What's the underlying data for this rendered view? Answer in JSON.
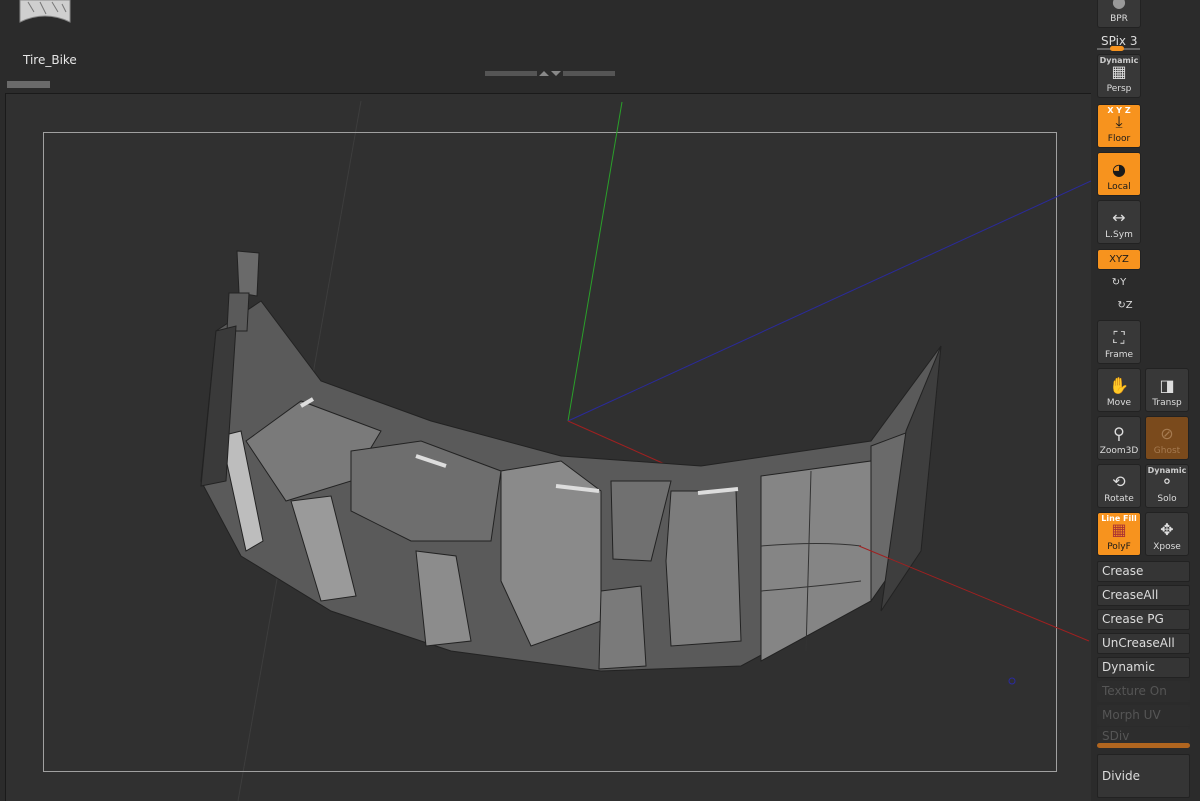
{
  "header": {
    "model_name": "Tire_Bike",
    "thumbnail": "tire-thumbnail"
  },
  "colors": {
    "accent": "#f7931e",
    "axis_x": "#b02020",
    "axis_y": "#20a020",
    "axis_z": "#2020a0"
  },
  "shelf": {
    "bpr": "BPR",
    "spix": "SPix 3",
    "spix_value": 3,
    "persp": {
      "top": "Dynamic",
      "label": "Persp"
    },
    "floor": {
      "top": "X Y Z",
      "label": "Floor",
      "active": true
    },
    "local": {
      "label": "Local",
      "active": true
    },
    "lsym": {
      "label": "L.Sym"
    },
    "rot_xyz": {
      "label": "XYZ",
      "active": true
    },
    "rot_y": "Y",
    "rot_z": "Z",
    "frame": "Frame",
    "move": "Move",
    "transp": "Transp",
    "zoom3d": "Zoom3D",
    "ghost": "Ghost",
    "rotate": "Rotate",
    "solo": {
      "top": "Dynamic",
      "label": "Solo"
    },
    "polyf": {
      "top": "Line Fill",
      "label": "PolyF",
      "active": true
    },
    "xpose": "Xpose"
  },
  "geometry_panel": {
    "buttons": [
      "Crease",
      "CreaseAll",
      "Crease PG",
      "UnCreaseAll",
      "Dynamic"
    ],
    "disabled": [
      "Texture On",
      "Morph UV",
      "SDiv"
    ],
    "divide": "Divide"
  }
}
